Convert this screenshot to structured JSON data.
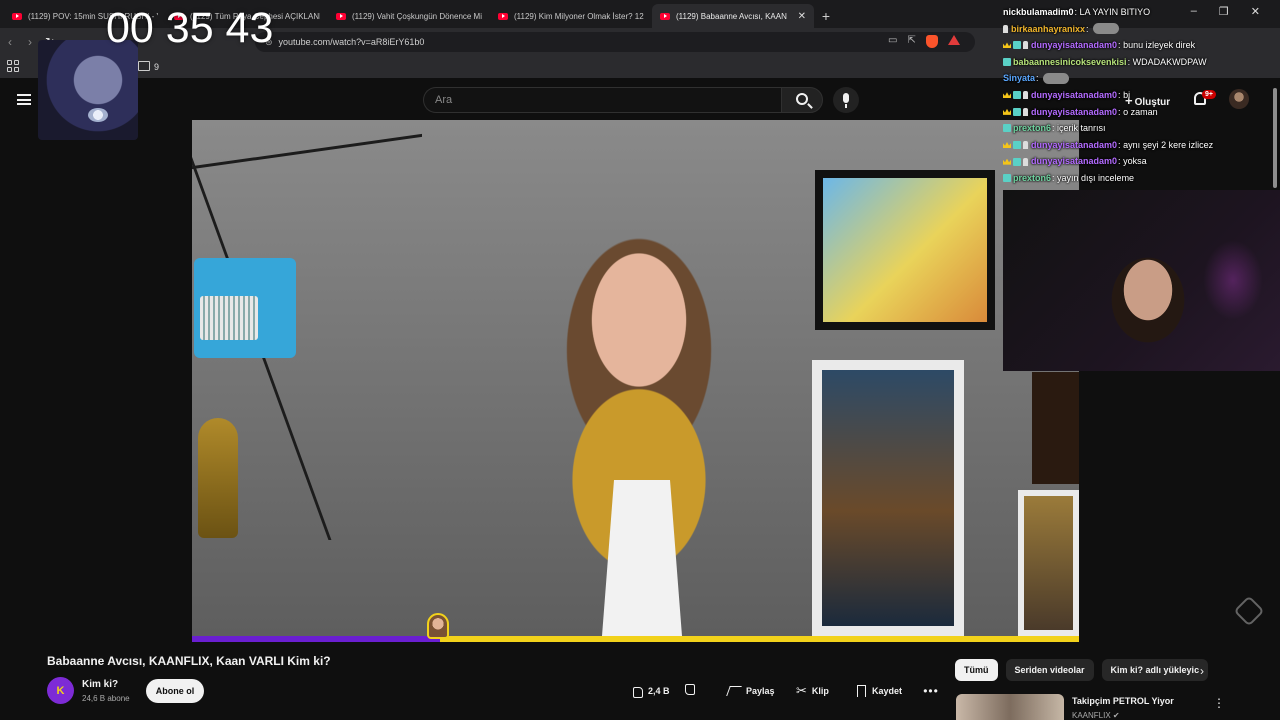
{
  "browser": {
    "tabs": [
      {
        "title": "(1129) POV: 15min SUSHI RUSH! - Yo",
        "active": false
      },
      {
        "title": "(1129) Tüm Rüya Cephesi AÇIKLAND",
        "active": false
      },
      {
        "title": "(1129) Vahit Çoşkungün Dönence Mi",
        "active": false
      },
      {
        "title": "(1129) Kim Milyoner Olmak İster? 12",
        "active": false
      },
      {
        "title": "(1129) Babaanne Avcısı, KAAN",
        "active": true
      }
    ],
    "close_glyph": "✕",
    "new_tab_glyph": "+",
    "url": "youtube.com/watch?v=aR8iErY61b0",
    "bookmarks_count": "9",
    "window_controls": [
      "–",
      "❐",
      "✕"
    ]
  },
  "youtube": {
    "search_placeholder": "Ara",
    "create_label": "Oluştur",
    "notification_count": "9+",
    "video": {
      "title": "Babaanne Avcısı, KAANFLIX, Kaan VARLI Kim ki?",
      "progress_fraction": 0.28
    },
    "channel": {
      "name": "Kim ki?",
      "subscribers": "24,6 B abone",
      "avatar_text": "K",
      "subscribe_label": "Abone ol"
    },
    "actions": {
      "like_count": "2,4 B",
      "share_label": "Paylaş",
      "clip_label": "Klip",
      "save_label": "Kaydet",
      "more_glyph": "•••"
    },
    "chips": [
      {
        "label": "Tümü",
        "active": true
      },
      {
        "label": "Seriden videolar",
        "active": false
      },
      {
        "label": "Kim ki? adlı yükleyic",
        "active": false
      }
    ],
    "chip_next_glyph": "›",
    "related": {
      "title": "Takipçim PETROL Yiyor",
      "channel": "KAANFLIX",
      "more_glyph": "⋮"
    }
  },
  "stream": {
    "timer": "00 35 43",
    "chat": [
      {
        "user": "nickbulamadim0",
        "color": "#ffffff",
        "message": "LA YAYIN BITIYO",
        "badges": [],
        "emote": false
      },
      {
        "user": "birkaanhayranixx",
        "color": "#f0b52c",
        "message": "",
        "badges": [
          "mod"
        ],
        "emote": true
      },
      {
        "user": "dunyayisatanadam0",
        "color": "#b36bff",
        "message": "bunu izleyek direk",
        "badges": [
          "crown",
          "badge",
          "mod"
        ],
        "emote": false
      },
      {
        "user": "babaannesinicoksevenkisi",
        "color": "#b6e37a",
        "message": "WDADAKWDPAW",
        "badges": [
          "badge"
        ],
        "emote": false
      },
      {
        "user": "Sinyata",
        "color": "#5aa7ff",
        "message": "",
        "badges": [],
        "emote": true
      },
      {
        "user": "dunyayisatanadam0",
        "color": "#b36bff",
        "message": "bi",
        "badges": [
          "crown",
          "badge",
          "mod"
        ],
        "emote": false
      },
      {
        "user": "dunyayisatanadam0",
        "color": "#b36bff",
        "message": "o zaman",
        "badges": [
          "crown",
          "badge",
          "mod"
        ],
        "emote": false
      },
      {
        "user": "prexton6",
        "color": "#6fd3a0",
        "message": "içerik tanrısı",
        "badges": [
          "badge"
        ],
        "emote": false
      },
      {
        "user": "dunyayisatanadam0",
        "color": "#b36bff",
        "message": "aynı şeyi 2 kere izlicez",
        "badges": [
          "crown",
          "badge",
          "mod"
        ],
        "emote": false
      },
      {
        "user": "dunyayisatanadam0",
        "color": "#b36bff",
        "message": "yoksa",
        "badges": [
          "crown",
          "badge",
          "mod"
        ],
        "emote": false
      },
      {
        "user": "prexton6",
        "color": "#6fd3a0",
        "message": "yayın dışı inceleme",
        "badges": [
          "badge"
        ],
        "emote": false
      }
    ]
  },
  "colors": {
    "progress_played": "#6a1fd1",
    "progress_track": "#f2d21b",
    "youtube_red": "#ff0033"
  }
}
